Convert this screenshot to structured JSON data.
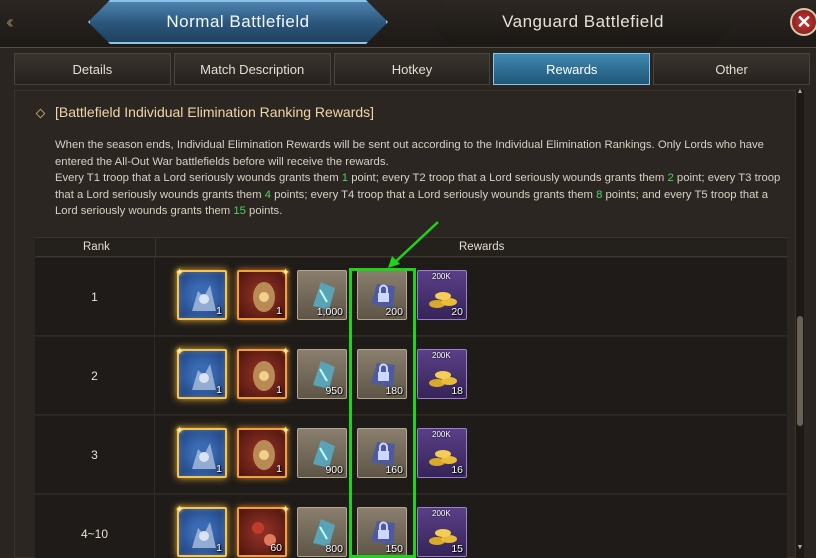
{
  "battlefield_tabs": {
    "normal": "Normal Battlefield",
    "vanguard": "Vanguard Battlefield"
  },
  "subtabs": [
    "Details",
    "Match Description",
    "Hotkey",
    "Rewards",
    "Other"
  ],
  "active_subtab": "Rewards",
  "section": {
    "heading": "[Battlefield Individual Elimination Ranking Rewards]",
    "desc_line1": "When the season ends, Individual Elimination Rewards will be sent out according to the Individual Elimination Rankings. Only Lords who have entered the All-Out War battlefields before will receive the rewards.",
    "desc_p2_a": "Every T1 troop that a Lord seriously wounds grants them ",
    "t1": "1",
    "desc_p2_b": " point; every T2 troop that a Lord seriously wounds grants them ",
    "t2": "2",
    "desc_p2_c": " point; every T3 troop that a Lord seriously wounds grants them ",
    "t3": "4",
    "desc_p2_d": " points; every T4 troop that a Lord seriously wounds grants them ",
    "t4": "8",
    "desc_p2_e": " points; and every T5 troop that a Lord seriously wounds grants them ",
    "t5": "15",
    "desc_p2_f": " points."
  },
  "table": {
    "col_rank": "Rank",
    "col_rewards": "Rewards",
    "rows": [
      {
        "rank": "1",
        "items": [
          "1",
          "1",
          "1,000",
          "200",
          "20"
        ],
        "tag": "200K"
      },
      {
        "rank": "2",
        "items": [
          "1",
          "1",
          "950",
          "180",
          "18"
        ],
        "tag": "200K"
      },
      {
        "rank": "3",
        "items": [
          "1",
          "1",
          "900",
          "160",
          "16"
        ],
        "tag": "200K"
      },
      {
        "rank": "4~10",
        "items": [
          "1",
          "60",
          "800",
          "150",
          "15"
        ],
        "tag": "200K"
      }
    ]
  },
  "colors": {
    "highlight": "#22d21a",
    "accent_blue": "#3f88b0",
    "gold_text": "#f0d6a6",
    "green_points": "#4fd25a"
  }
}
